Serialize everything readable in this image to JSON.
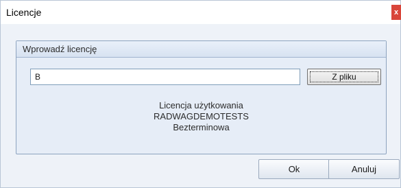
{
  "window": {
    "title": "Licencje",
    "close_label": "x"
  },
  "group": {
    "title": "Wprowadź licencję"
  },
  "license_input": {
    "value": "B"
  },
  "buttons": {
    "from_file": "Z pliku",
    "ok": "Ok",
    "cancel": "Anuluj"
  },
  "license_info": {
    "line1": "Licencja użytkowania",
    "line2": "RADWAGDEMOTESTS",
    "line3": "Bezterminowa"
  },
  "colors": {
    "titlebar_bg": "#ffffff",
    "window_bg": "#eef2f8",
    "group_bg": "#e6edf7",
    "close_button": "#d9463b"
  }
}
